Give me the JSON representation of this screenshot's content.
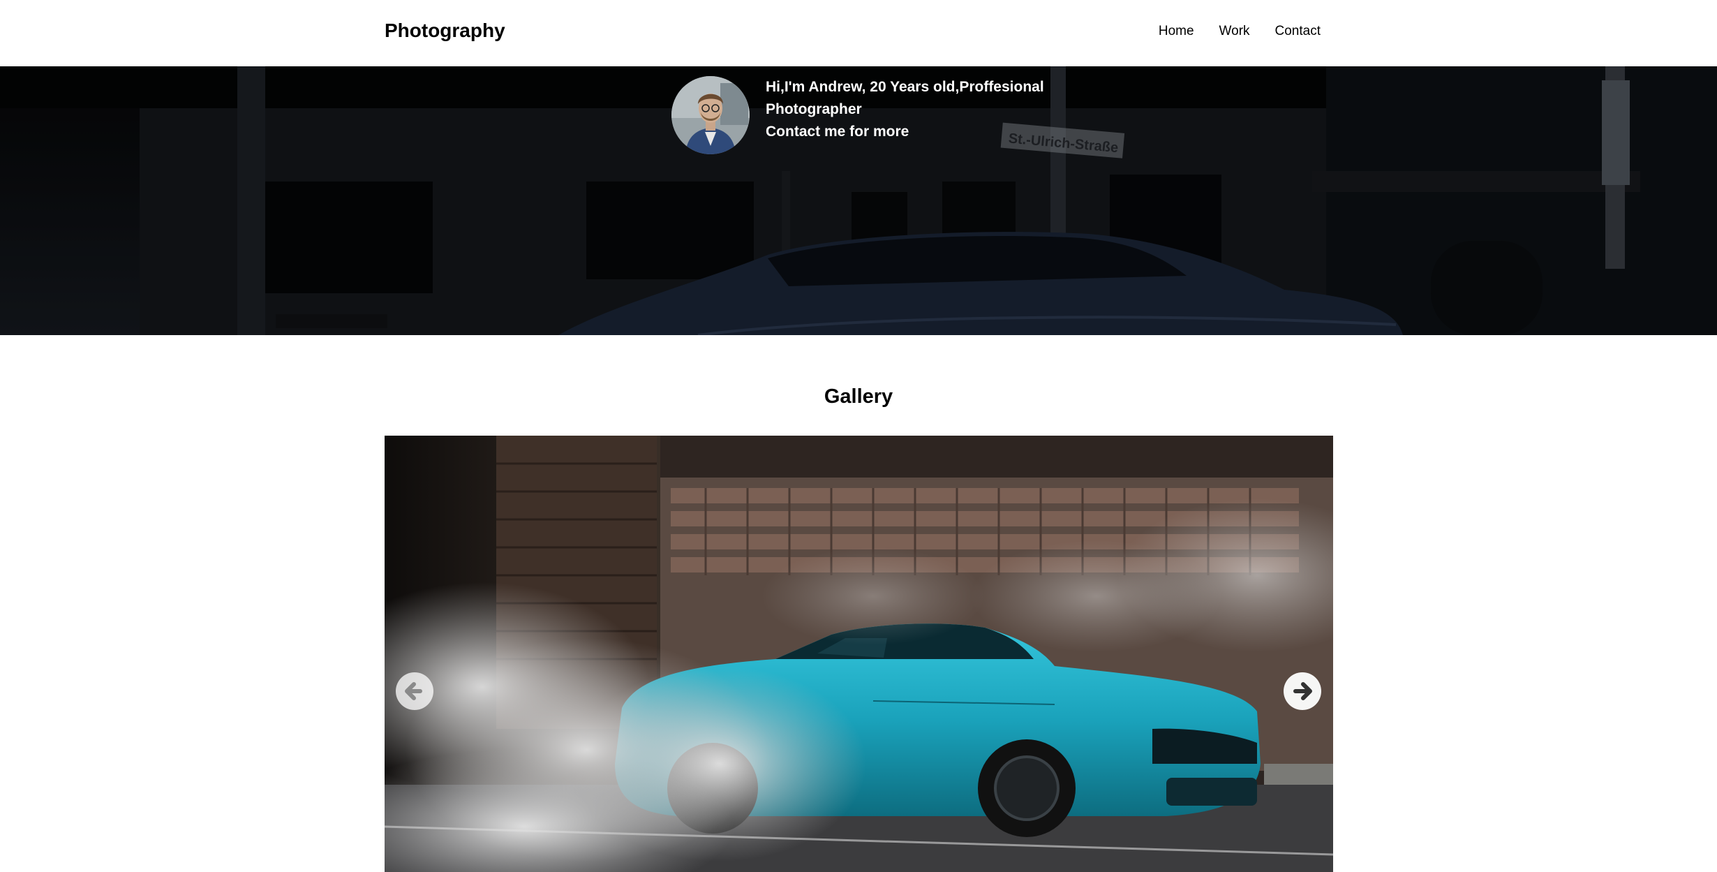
{
  "header": {
    "brand": "Photography",
    "nav": [
      "Home",
      "Work",
      "Contact"
    ]
  },
  "hero": {
    "intro": "Hi,I'm Andrew, 20 Years old,Proffesional Photographer",
    "cta": "Contact me for more",
    "street_sign": "St.-Ulrich-Straße"
  },
  "gallery": {
    "title": "Gallery",
    "prev_icon": "arrow-left-circle-icon",
    "next_icon": "arrow-right-circle-icon"
  }
}
